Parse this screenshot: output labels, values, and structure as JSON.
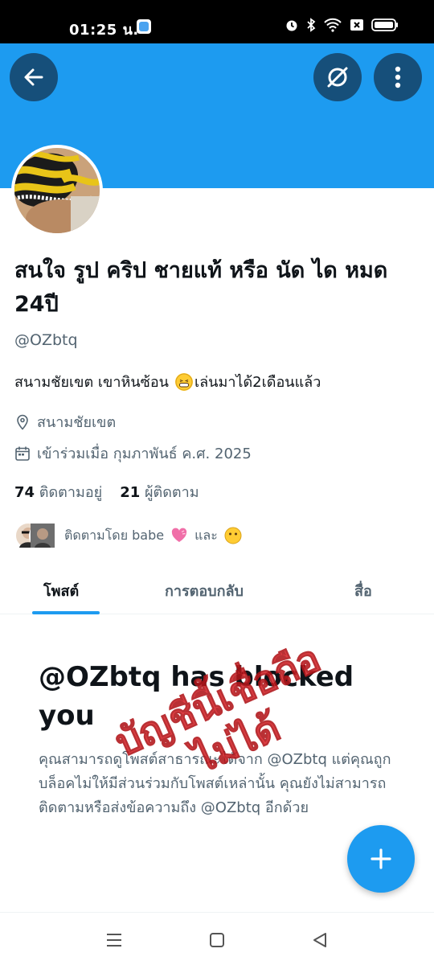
{
  "status_bar": {
    "time": "01:25 น.",
    "icons": [
      "app-notification-icon",
      "alarm-icon",
      "bluetooth-icon",
      "wifi-icon",
      "sim-off-icon",
      "battery-icon"
    ]
  },
  "header": {
    "back_icon": "arrow-left-icon",
    "grok_icon": "slashed-circle-icon",
    "more_icon": "more-vertical-icon"
  },
  "profile": {
    "display_name": "สนใจ รูป คริป ชายแท้ หรือ นัด ได หมด 24ปี",
    "handle": "@OZbtq",
    "bio_text": "สนามชัยเขต เขาหินซ้อน",
    "bio_text_2": "เล่นมาได้2เดือนแล้ว",
    "location": "สนามชัยเขต",
    "joined": "เข้าร่วมเมื่อ กุมภาพันธ์ ค.ศ. 2025",
    "following_count": "74",
    "following_label": "ติดตามอยู่",
    "followers_count": "21",
    "followers_label": "ผู้ติดตาม",
    "followed_by": "ติดตามโดย babe",
    "followed_by_and": "และ"
  },
  "tabs": [
    {
      "label": "โพสต์",
      "active": true
    },
    {
      "label": "การตอบกลับ",
      "active": false
    },
    {
      "label": "สื่อ",
      "active": false
    }
  ],
  "blocked": {
    "title": "@OZbtq has blocked you",
    "description": "คุณสามารถดูโพสต์สาธารณะได้จาก @OZbtq แต่คุณถูกบล็อคไม่ให้มีส่วนร่วมกับโพสต์เหล่านั้น คุณยังไม่สามารถติดตามหรือส่งข้อความถึง @OZbtq อีกด้วย"
  },
  "watermark": {
    "line1": "บัญชีนี้เชื่อถือ",
    "line2": "ไม่ได้"
  },
  "colors": {
    "accent": "#1d9bf0",
    "header_button": "#164f7a",
    "watermark": "#e0242a",
    "text_primary": "#0f1419",
    "text_secondary": "#536471"
  }
}
